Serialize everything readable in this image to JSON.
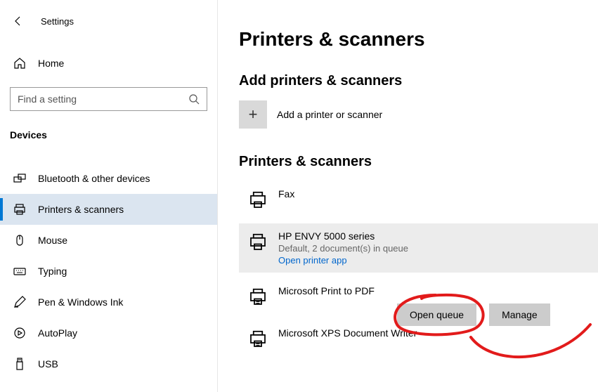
{
  "app": {
    "title": "Settings"
  },
  "sidebar": {
    "home": "Home",
    "search_placeholder": "Find a setting",
    "category": "Devices",
    "items": [
      {
        "label": "Bluetooth & other devices"
      },
      {
        "label": "Printers & scanners"
      },
      {
        "label": "Mouse"
      },
      {
        "label": "Typing"
      },
      {
        "label": "Pen & Windows Ink"
      },
      {
        "label": "AutoPlay"
      },
      {
        "label": "USB"
      }
    ]
  },
  "main": {
    "page_title": "Printers & scanners",
    "add_section_title": "Add printers & scanners",
    "add_label": "Add a printer or scanner",
    "list_section_title": "Printers & scanners",
    "printers": [
      {
        "name": "Fax"
      },
      {
        "name": "HP ENVY 5000 series",
        "sub": "Default, 2 document(s) in queue",
        "link": "Open printer app"
      },
      {
        "name": "Microsoft Print to PDF"
      },
      {
        "name": "Microsoft XPS Document Writer"
      }
    ],
    "actions": {
      "open_queue": "Open queue",
      "manage": "Manage"
    }
  }
}
